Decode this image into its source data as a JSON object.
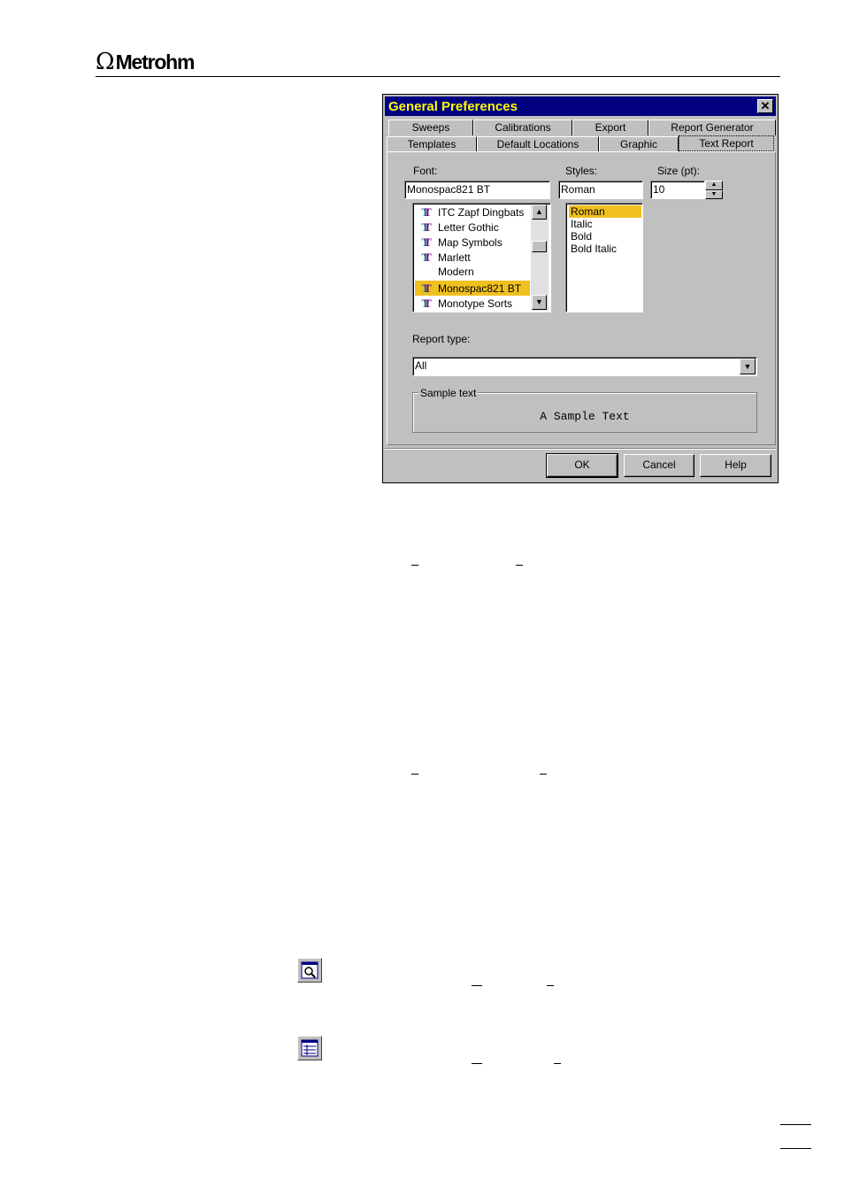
{
  "header": {
    "logo_symbol": "Ω",
    "logo_text": "Metrohm"
  },
  "dialog": {
    "title": "General Preferences",
    "close_label": "✕",
    "tabs_row1": [
      "Sweeps",
      "Calibrations",
      "Export",
      "Report Generator"
    ],
    "tabs_row2": [
      "Templates",
      "Default Locations",
      "Graphic",
      "Text Report"
    ],
    "active_tab": "Text Report",
    "font_label": "Font:",
    "font_value": "Monospac821 BT",
    "styles_label": "Styles:",
    "style_value": "Roman",
    "size_label": "Size (pt):",
    "size_value": "10",
    "font_list": [
      {
        "name": "ITC Zapf Dingbats",
        "truetype": true
      },
      {
        "name": "Letter Gothic",
        "truetype": true
      },
      {
        "name": "Map Symbols",
        "truetype": true
      },
      {
        "name": "Marlett",
        "truetype": true
      },
      {
        "name": "Modern",
        "truetype": false
      },
      {
        "name": "Monospac821 BT",
        "truetype": true
      },
      {
        "name": "Monotype Sorts",
        "truetype": true
      }
    ],
    "selected_font": "Monospac821 BT",
    "style_list": [
      "Roman",
      "Italic",
      "Bold",
      "Bold Italic"
    ],
    "selected_style": "Roman",
    "report_type_label": "Report type:",
    "report_type_value": "All",
    "sample_group_label": "Sample text",
    "sample_text": "A Sample Text",
    "buttons": {
      "ok": "OK",
      "cancel": "Cancel",
      "help": "Help"
    }
  },
  "icons": [
    "zoom-window-icon",
    "table-window-icon"
  ],
  "colors": {
    "titlebar": "#000080",
    "title_text": "#ffff00",
    "selection": "#f0c020",
    "dialog_bg": "#c0c0c0"
  }
}
